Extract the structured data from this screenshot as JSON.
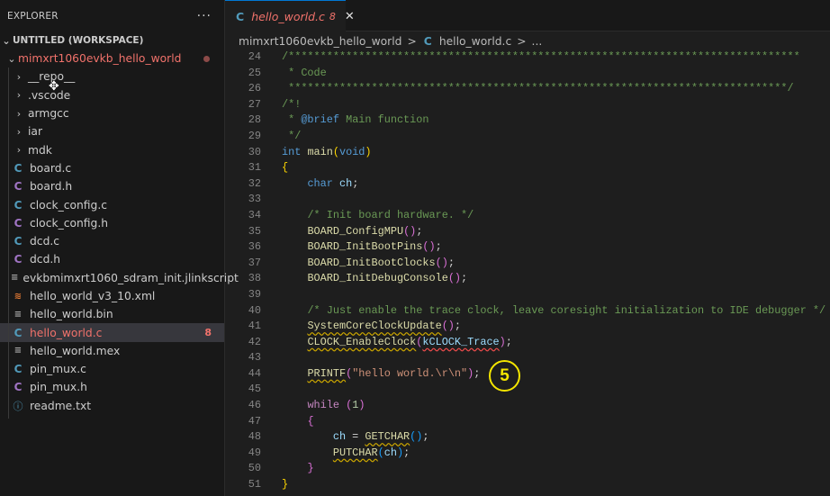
{
  "explorer": {
    "title": "EXPLORER",
    "more": "···",
    "workspace": "UNTITLED (WORKSPACE)",
    "folder": "mimxrt1060evkb_hello_world",
    "items": [
      {
        "label": "__repo__",
        "type": "folder"
      },
      {
        "label": ".vscode",
        "type": "folder"
      },
      {
        "label": "armgcc",
        "type": "folder"
      },
      {
        "label": "iar",
        "type": "folder"
      },
      {
        "label": "mdk",
        "type": "folder"
      },
      {
        "label": "board.c",
        "type": "c"
      },
      {
        "label": "board.h",
        "type": "h"
      },
      {
        "label": "clock_config.c",
        "type": "c"
      },
      {
        "label": "clock_config.h",
        "type": "h"
      },
      {
        "label": "dcd.c",
        "type": "c"
      },
      {
        "label": "dcd.h",
        "type": "h"
      },
      {
        "label": "evkbmimxrt1060_sdram_init.jlinkscript",
        "type": "text"
      },
      {
        "label": "hello_world_v3_10.xml",
        "type": "xml"
      },
      {
        "label": "hello_world.bin",
        "type": "text"
      },
      {
        "label": "hello_world.c",
        "type": "c",
        "selected": true,
        "errors": "8"
      },
      {
        "label": "hello_world.mex",
        "type": "text"
      },
      {
        "label": "pin_mux.c",
        "type": "c"
      },
      {
        "label": "pin_mux.h",
        "type": "h"
      },
      {
        "label": "readme.txt",
        "type": "info"
      }
    ]
  },
  "tab": {
    "icon": "C",
    "label": "hello_world.c",
    "problems": "8",
    "close": "✕"
  },
  "breadcrumb": {
    "folder": "mimxrt1060evkb_hello_world",
    "sep": ">",
    "icon": "C",
    "file": "hello_world.c",
    "more": "..."
  },
  "step_badge": "5",
  "code": [
    {
      "n": "24",
      "t": [
        [
          "/********************************************************************************",
          "cm"
        ]
      ]
    },
    {
      "n": "25",
      "t": [
        [
          " * Code",
          "cm"
        ]
      ]
    },
    {
      "n": "26",
      "t": [
        [
          " ******************************************************************************/",
          "cm"
        ]
      ]
    },
    {
      "n": "27",
      "t": [
        [
          "/*!",
          "cm"
        ]
      ]
    },
    {
      "n": "28",
      "t": [
        [
          " * ",
          "cm"
        ],
        [
          "@brief",
          "kw"
        ],
        [
          " Main function",
          "cm"
        ]
      ]
    },
    {
      "n": "29",
      "t": [
        [
          " */",
          "cm"
        ]
      ]
    },
    {
      "n": "30",
      "t": [
        [
          "int ",
          "kw"
        ],
        [
          "main",
          "fn"
        ],
        [
          "(",
          "p1"
        ],
        [
          "void",
          "kw"
        ],
        [
          ")",
          "p1"
        ]
      ]
    },
    {
      "n": "31",
      "t": [
        [
          "{",
          "p1"
        ]
      ]
    },
    {
      "n": "32",
      "t": [
        [
          "    ",
          ""
        ],
        [
          "char ",
          "kw"
        ],
        [
          "ch",
          "var"
        ],
        [
          ";",
          "d"
        ]
      ]
    },
    {
      "n": "33",
      "t": []
    },
    {
      "n": "34",
      "t": [
        [
          "    ",
          ""
        ],
        [
          "/* Init board hardware. */",
          "cm"
        ]
      ]
    },
    {
      "n": "35",
      "t": [
        [
          "    ",
          ""
        ],
        [
          "BOARD_ConfigMPU",
          "fn"
        ],
        [
          "()",
          "p2"
        ],
        [
          ";",
          "d"
        ]
      ]
    },
    {
      "n": "36",
      "t": [
        [
          "    ",
          ""
        ],
        [
          "BOARD_InitBootPins",
          "fn"
        ],
        [
          "()",
          "p2"
        ],
        [
          ";",
          "d"
        ]
      ]
    },
    {
      "n": "37",
      "t": [
        [
          "    ",
          ""
        ],
        [
          "BOARD_InitBootClocks",
          "fn"
        ],
        [
          "()",
          "p2"
        ],
        [
          ";",
          "d"
        ]
      ]
    },
    {
      "n": "38",
      "t": [
        [
          "    ",
          ""
        ],
        [
          "BOARD_InitDebugConsole",
          "fn"
        ],
        [
          "()",
          "p2"
        ],
        [
          ";",
          "d"
        ]
      ]
    },
    {
      "n": "39",
      "t": []
    },
    {
      "n": "40",
      "t": [
        [
          "    ",
          ""
        ],
        [
          "/* Just enable the trace clock, leave coresight initialization to IDE debugger */",
          "cm"
        ]
      ]
    },
    {
      "n": "41",
      "t": [
        [
          "    ",
          ""
        ],
        [
          "SystemCoreClockUpdate",
          "fn sqy"
        ],
        [
          "()",
          "p2"
        ],
        [
          ";",
          "d"
        ]
      ]
    },
    {
      "n": "42",
      "t": [
        [
          "    ",
          ""
        ],
        [
          "CLOCK_EnableClock",
          "fn sqy"
        ],
        [
          "(",
          "p2"
        ],
        [
          "kCLOCK_Trace",
          "var sqr"
        ],
        [
          ")",
          "p2"
        ],
        [
          ";",
          "d"
        ]
      ]
    },
    {
      "n": "43",
      "t": []
    },
    {
      "n": "44",
      "t": [
        [
          "    ",
          ""
        ],
        [
          "PRINTF",
          "fn sqy"
        ],
        [
          "(",
          "p2"
        ],
        [
          "\"hello world.\\r\\n\"",
          "str"
        ],
        [
          ")",
          "p2"
        ],
        [
          ";",
          "d"
        ]
      ]
    },
    {
      "n": "45",
      "t": []
    },
    {
      "n": "46",
      "t": [
        [
          "    ",
          ""
        ],
        [
          "while ",
          "ctl"
        ],
        [
          "(",
          "p2"
        ],
        [
          "1",
          "num"
        ],
        [
          ")",
          "p2"
        ]
      ]
    },
    {
      "n": "47",
      "t": [
        [
          "    ",
          ""
        ],
        [
          "{",
          "p2"
        ]
      ]
    },
    {
      "n": "48",
      "t": [
        [
          "        ",
          ""
        ],
        [
          "ch",
          "var"
        ],
        [
          " = ",
          "d"
        ],
        [
          "GETCHAR",
          "fn sqy"
        ],
        [
          "()",
          "p3"
        ],
        [
          ";",
          "d"
        ]
      ]
    },
    {
      "n": "49",
      "t": [
        [
          "        ",
          ""
        ],
        [
          "PUTCHAR",
          "fn sqy"
        ],
        [
          "(",
          "p3"
        ],
        [
          "ch",
          "var"
        ],
        [
          ")",
          "p3"
        ],
        [
          ";",
          "d"
        ]
      ]
    },
    {
      "n": "50",
      "t": [
        [
          "    ",
          ""
        ],
        [
          "}",
          "p2"
        ]
      ]
    },
    {
      "n": "51",
      "t": [
        [
          "}",
          "p1"
        ]
      ]
    }
  ]
}
